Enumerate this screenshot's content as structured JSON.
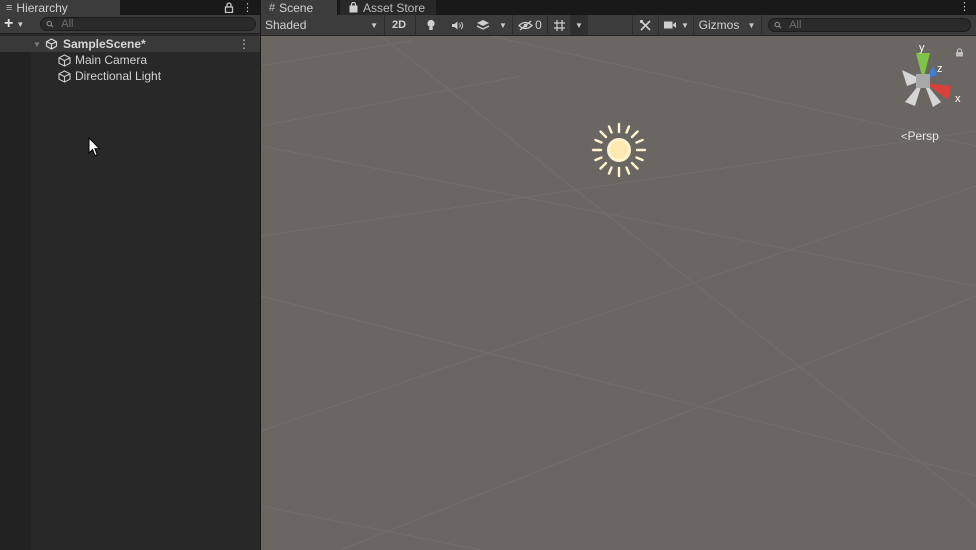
{
  "hierarchy": {
    "tab_label": "Hierarchy",
    "search_placeholder": "All",
    "scene_name": "SampleScene*",
    "items": [
      {
        "label": "Main Camera",
        "icon": "cube-icon"
      },
      {
        "label": "Directional Light",
        "icon": "cube-icon"
      }
    ]
  },
  "scene_view": {
    "tabs": [
      {
        "label": "Scene",
        "icon": "grid-icon"
      },
      {
        "label": "Asset Store",
        "icon": "shopping-bag-icon"
      }
    ],
    "toolbar": {
      "shading_mode": "Shaded",
      "mode_2d": "2D",
      "hidden_count": "0",
      "gizmos_label": "Gizmos",
      "search_placeholder": "All"
    },
    "gizmo_axes": {
      "y": "y",
      "z": "z",
      "x": "x"
    },
    "projection_label": "Persp"
  },
  "colors": {
    "panel_bg": "#282828",
    "toolbar_bg": "#3c3c3c",
    "viewport_bg": "#6a6763",
    "axis_x": "#d9403a",
    "axis_y": "#7cc44a",
    "axis_z": "#3f7fd6",
    "sun": "#fff3d0"
  }
}
